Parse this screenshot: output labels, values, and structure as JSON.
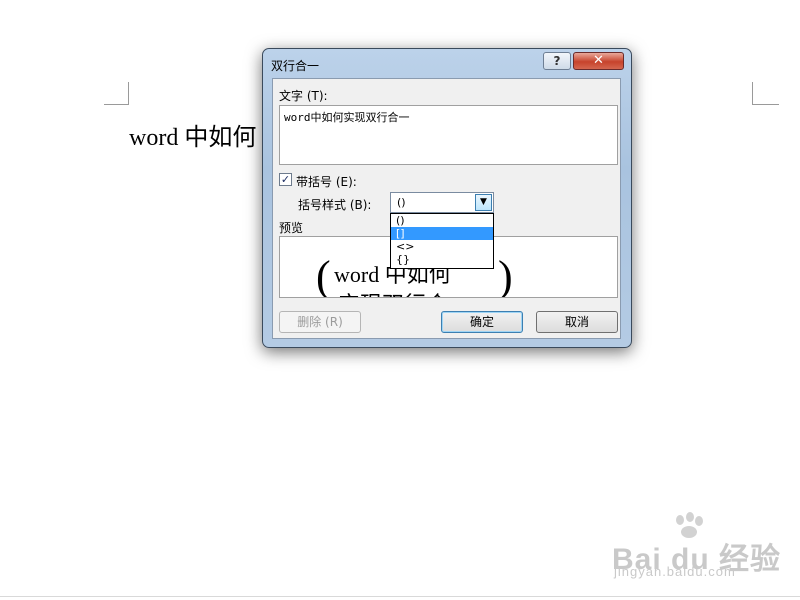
{
  "document": {
    "text": "word 中如何"
  },
  "dialog": {
    "title": "双行合一",
    "help_label": "?",
    "close_label": "✕",
    "text_label": "文字 (T):",
    "text_value": "word中如何实现双行合一",
    "bracket_checkbox_label": "带括号 (E):",
    "bracket_checkbox_mark": "✓",
    "bracket_checked": true,
    "bracket_style_label": "括号样式 (B):",
    "bracket_style_value": "()",
    "bracket_options": [
      "()",
      "[]",
      "<>",
      "{}"
    ],
    "selected_option_index": 1,
    "preview_label": "预览",
    "preview": {
      "open_paren": "(",
      "close_paren": ")",
      "line1": "word 中如何",
      "line2": "实现双行合一"
    },
    "delete_button": "删除 (R)",
    "ok_button": "确定",
    "cancel_button": "取消"
  },
  "watermark": {
    "logo": "Bai du 经验",
    "url": "jingyan.baidu.com"
  },
  "colors": {
    "selection": "#3399ff",
    "title_bar": "#bcd2ea",
    "close_button": "#c7432c"
  }
}
